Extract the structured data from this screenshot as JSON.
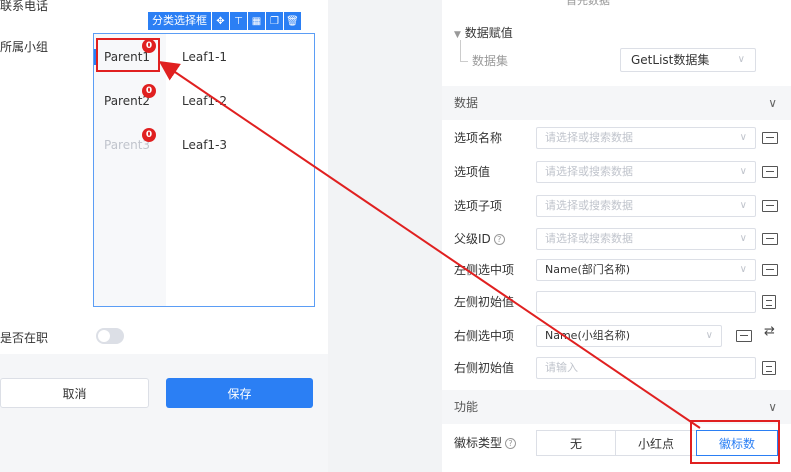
{
  "left": {
    "top_label": "联系电话",
    "group_label": "所属小组",
    "toolbar": {
      "title": "分类选择框",
      "icons": [
        "move-icon",
        "pin-top-icon",
        "table-icon",
        "copy-icon",
        "delete-icon"
      ]
    },
    "parents": [
      {
        "label": "Parent1",
        "badge": "0"
      },
      {
        "label": "Parent2",
        "badge": "0"
      },
      {
        "label": "Parent3",
        "badge": "0"
      }
    ],
    "leaves": [
      "Leaf1-1",
      "Leaf1-2",
      "Leaf1-3"
    ],
    "active_label": "是否在职",
    "cancel": "取消",
    "save": "保存"
  },
  "right": {
    "top_cut": "首先数据",
    "binding": {
      "title": "数据赋值",
      "dataset_label": "数据集",
      "dataset_value": "GetList数据集"
    },
    "data_section": "数据",
    "props": {
      "option_name": {
        "label": "选项名称",
        "placeholder": "请选择或搜索数据"
      },
      "option_value": {
        "label": "选项值",
        "placeholder": "请选择或搜索数据"
      },
      "option_child": {
        "label": "选项子项",
        "placeholder": "请选择或搜索数据"
      },
      "parent_id": {
        "label": "父级ID",
        "placeholder": "请选择或搜索数据"
      },
      "left_selected": {
        "label": "左侧选中项",
        "value": "Name(部门名称)"
      },
      "left_initial": {
        "label": "左侧初始值",
        "value": ""
      },
      "right_selected": {
        "label": "右侧选中项",
        "value": "Name(小组名称)"
      },
      "right_initial": {
        "label": "右侧初始值",
        "placeholder": "请输入"
      }
    },
    "function_section": "功能",
    "badge_type": {
      "label": "徽标类型",
      "options": [
        "无",
        "小红点",
        "徽标数"
      ],
      "selected": "徽标数"
    }
  },
  "colors": {
    "accent": "#2b7ff4",
    "annotation": "#e02020"
  }
}
